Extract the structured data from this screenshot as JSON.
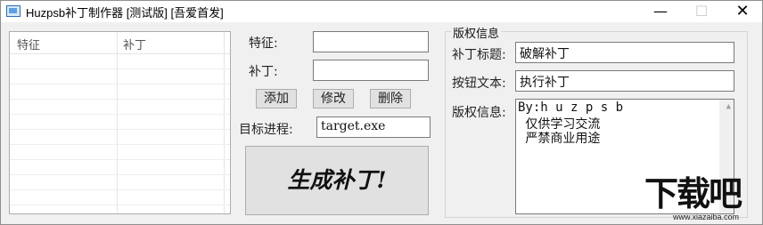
{
  "window": {
    "title": "Huzpsb补丁制作器 [测试版] [吾爱首发]",
    "controls": {
      "minimize": "—",
      "maximize": "☐",
      "close": "✕"
    }
  },
  "table": {
    "columns": [
      "特征",
      "补丁"
    ],
    "rows": []
  },
  "form": {
    "feature_label": "特征:",
    "feature_value": "",
    "patch_label": "补丁:",
    "patch_value": "",
    "add_button": "添加",
    "edit_button": "修改",
    "delete_button": "删除",
    "target_label": "目标进程:",
    "target_value": "target.exe",
    "generate_button": "生成补丁!"
  },
  "copyright": {
    "group_title": "版权信息",
    "patch_title_label": "补丁标题:",
    "patch_title_value": "破解补丁",
    "button_text_label": "按钮文本:",
    "button_text_value": "执行补丁",
    "info_label": "版权信息:",
    "info_lines": [
      "By:h u z p s b",
      " 仅供学习交流",
      " 严禁商业用途"
    ]
  },
  "watermark": {
    "brand": "下载吧",
    "url": "www.xiazaiba.com"
  }
}
